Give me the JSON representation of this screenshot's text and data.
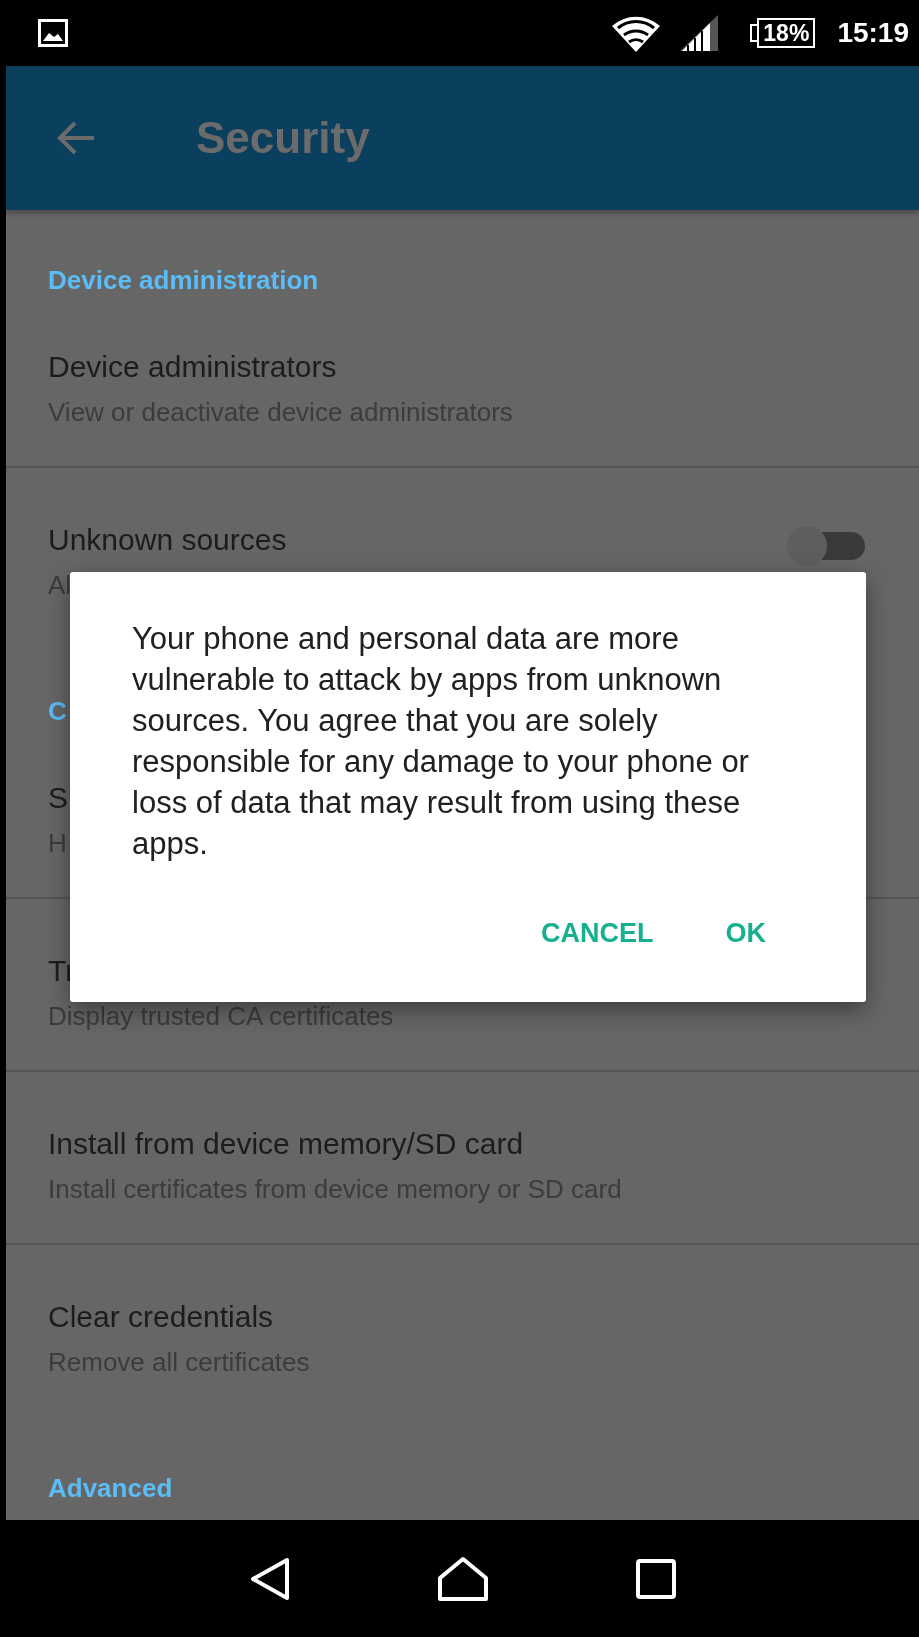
{
  "status_bar": {
    "battery": "18%",
    "time": "15:19"
  },
  "app_bar": {
    "title": "Security"
  },
  "sections": [
    {
      "header": "Device administration",
      "items": [
        {
          "kind": "plain",
          "title": "Device administrators",
          "subtitle": "View or deactivate device administrators"
        },
        {
          "kind": "switch",
          "title": "Unknown sources",
          "subtitle": "Al",
          "on": false
        }
      ]
    },
    {
      "header": "C",
      "items": [
        {
          "kind": "plain",
          "title": "S",
          "subtitle": "H"
        },
        {
          "kind": "plain",
          "title": "Tr",
          "subtitle": "Display trusted CA certificates"
        },
        {
          "kind": "plain",
          "title": "Install from device memory/SD card",
          "subtitle": "Install certificates from device memory or SD card"
        },
        {
          "kind": "plain",
          "title": "Clear credentials",
          "subtitle": "Remove all certificates"
        }
      ]
    },
    {
      "header": "Advanced"
    }
  ],
  "dialog": {
    "message": "Your phone and personal data are more vulnerable to attack by apps from unknown sources. You agree that you are solely responsible for any damage to your phone or loss of data that may result from using these apps.",
    "buttons": [
      "CANCEL",
      "OK"
    ]
  }
}
